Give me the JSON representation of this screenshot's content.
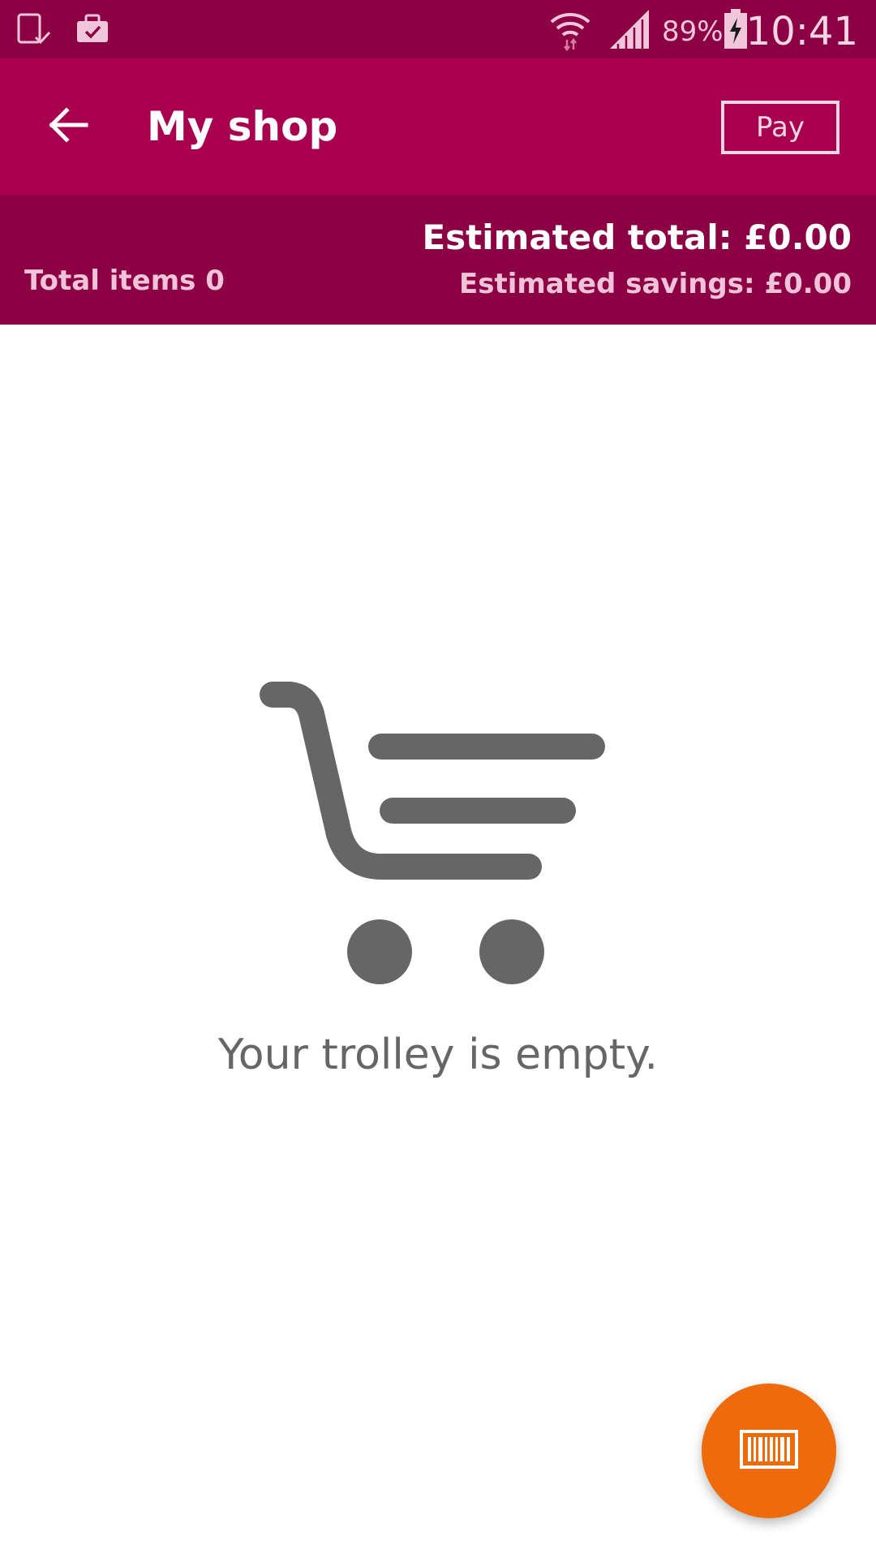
{
  "status_bar": {
    "battery_percent": "89%",
    "time": "10:41",
    "icons": [
      "device-check-icon",
      "briefcase-check-icon",
      "wifi-icon",
      "signal-icon",
      "battery-charging-icon"
    ]
  },
  "app_bar": {
    "title": "My shop",
    "pay_label": "Pay",
    "back_icon": "arrow-left-icon"
  },
  "summary": {
    "total_items": "Total items 0",
    "estimated_total": "Estimated total: £0.00",
    "estimated_savings": "Estimated savings: £0.00"
  },
  "empty_state": {
    "icon": "trolley-icon",
    "message": "Your trolley is empty."
  },
  "fab": {
    "icon": "barcode-icon"
  },
  "colors": {
    "status_bar": "#8c0044",
    "app_bar": "#a8004f",
    "summary_bar": "#8c0044",
    "fab": "#ee6a0a",
    "empty_icon": "#666666"
  }
}
